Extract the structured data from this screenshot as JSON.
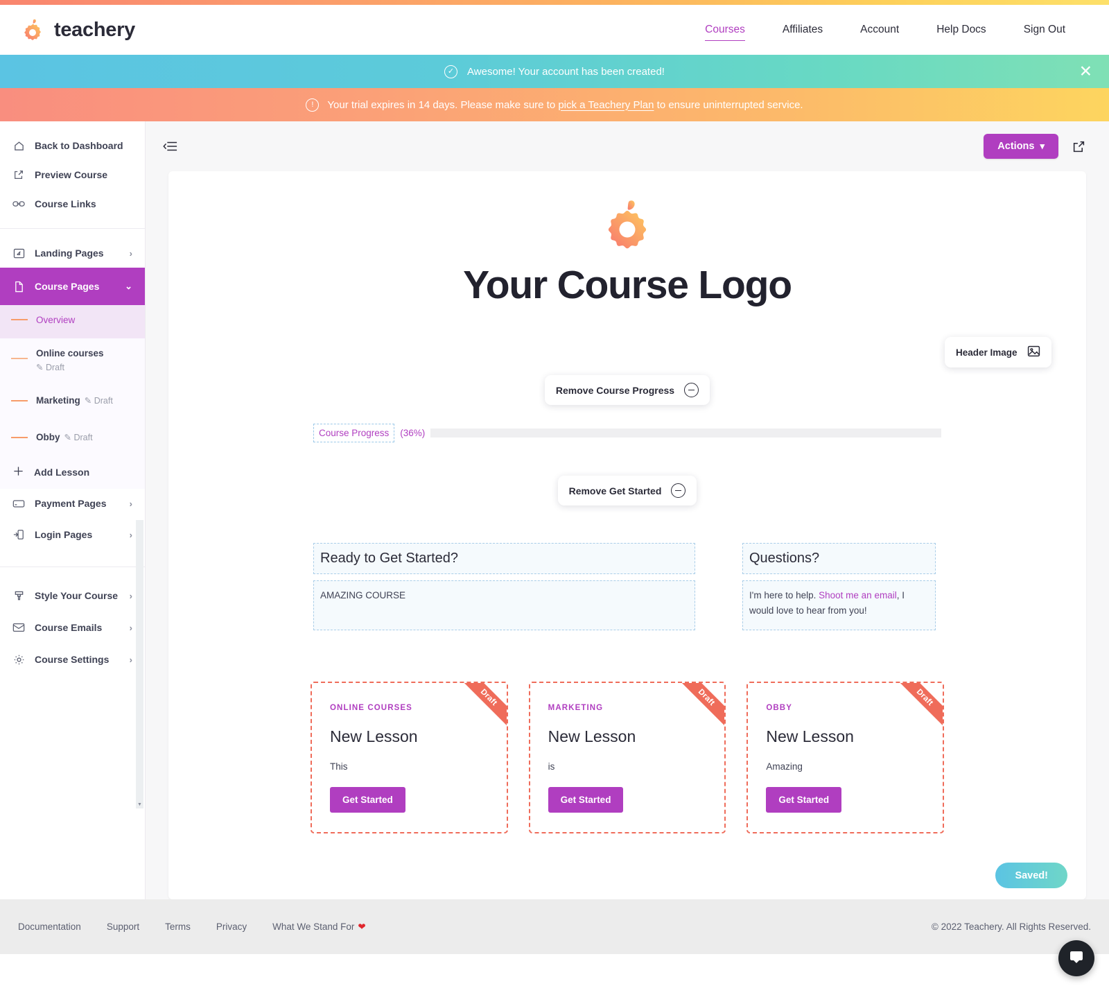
{
  "brand": {
    "name": "teachery"
  },
  "nav": {
    "items": [
      {
        "label": "Courses",
        "active": true
      },
      {
        "label": "Affiliates",
        "active": false
      },
      {
        "label": "Account",
        "active": false
      },
      {
        "label": "Help Docs",
        "active": false
      },
      {
        "label": "Sign Out",
        "active": false
      }
    ]
  },
  "banners": {
    "success": {
      "text": "Awesome! Your account has been created!",
      "close": "✕",
      "icon": "check-circle-icon"
    },
    "warning": {
      "pre": "Your trial expires in 14 days. Please make sure to ",
      "link": "pick a Teachery Plan",
      "post": " to ensure uninterrupted service.",
      "icon": "alert-circle-icon"
    }
  },
  "sidebar": {
    "top": [
      {
        "label": "Back to Dashboard",
        "icon": "home-icon"
      },
      {
        "label": "Preview Course",
        "icon": "external-link-icon"
      },
      {
        "label": "Course Links",
        "icon": "link-icon"
      }
    ],
    "pages": [
      {
        "label": "Landing Pages",
        "icon": "landing-page-icon",
        "chevron": "›",
        "active": false
      },
      {
        "label": "Course Pages",
        "icon": "document-icon",
        "chevron": "⌄",
        "active": true
      }
    ],
    "lessons": [
      {
        "name": "Overview",
        "draft": "",
        "selected": true,
        "inline": false
      },
      {
        "name": "Online courses",
        "draft": "✎ Draft",
        "selected": false,
        "inline": false
      },
      {
        "name": "Marketing",
        "draft": "✎ Draft",
        "selected": false,
        "inline": true
      },
      {
        "name": "Obby",
        "draft": "✎ Draft",
        "selected": false,
        "inline": true
      }
    ],
    "add_lesson": {
      "label": "Add Lesson",
      "icon": "plus-icon"
    },
    "pages2": [
      {
        "label": "Payment Pages",
        "icon": "card-icon",
        "chevron": "›"
      },
      {
        "label": "Login Pages",
        "icon": "login-icon",
        "chevron": "›"
      }
    ],
    "settings": [
      {
        "label": "Style Your Course",
        "icon": "paint-icon",
        "chevron": "›"
      },
      {
        "label": "Course Emails",
        "icon": "mail-icon",
        "chevron": "›"
      },
      {
        "label": "Course Settings",
        "icon": "gear-icon",
        "chevron": "›"
      }
    ]
  },
  "toolbar": {
    "collapse_icon": "collapse-sidebar-icon",
    "actions_label": "Actions",
    "actions_caret": "⌄",
    "external_icon": "open-external-icon"
  },
  "canvas": {
    "logo_title": "Your Course Logo",
    "header_image_chip": {
      "label": "Header Image",
      "icon": "image-icon"
    },
    "remove_progress_chip": "Remove Course Progress",
    "remove_get_started_chip": "Remove Get Started",
    "progress": {
      "label": "Course Progress",
      "percent_text": "(36%)",
      "percent": 36
    },
    "get_started": {
      "heading": "Ready to Get Started?",
      "body": "AMAZING COURSE"
    },
    "questions": {
      "heading": "Questions?",
      "body_pre": "I'm here to help. ",
      "body_link": "Shoot me an email",
      "body_post": ", I would love to hear from you!"
    },
    "cards": [
      {
        "category": "ONLINE COURSES",
        "title": "New Lesson",
        "desc": "This",
        "button": "Get Started",
        "ribbon": "Draft"
      },
      {
        "category": "MARKETING",
        "title": "New Lesson",
        "desc": "is",
        "button": "Get Started",
        "ribbon": "Draft"
      },
      {
        "category": "OBBY",
        "title": "New Lesson",
        "desc": "Amazing",
        "button": "Get Started",
        "ribbon": "Draft"
      }
    ],
    "saved_button": "Saved!"
  },
  "footer": {
    "links": [
      "Documentation",
      "Support",
      "Terms",
      "Privacy"
    ],
    "stand_for": "What We Stand For",
    "heart": "❤",
    "copyright": "© 2022 Teachery. All Rights Reserved."
  },
  "chat": {
    "icon": "chat-icon"
  },
  "colors": {
    "accent": "#b03ec0",
    "orange": "#f79c6a",
    "draft_red": "#ef6c5a",
    "teal": "#5bc4e3"
  }
}
